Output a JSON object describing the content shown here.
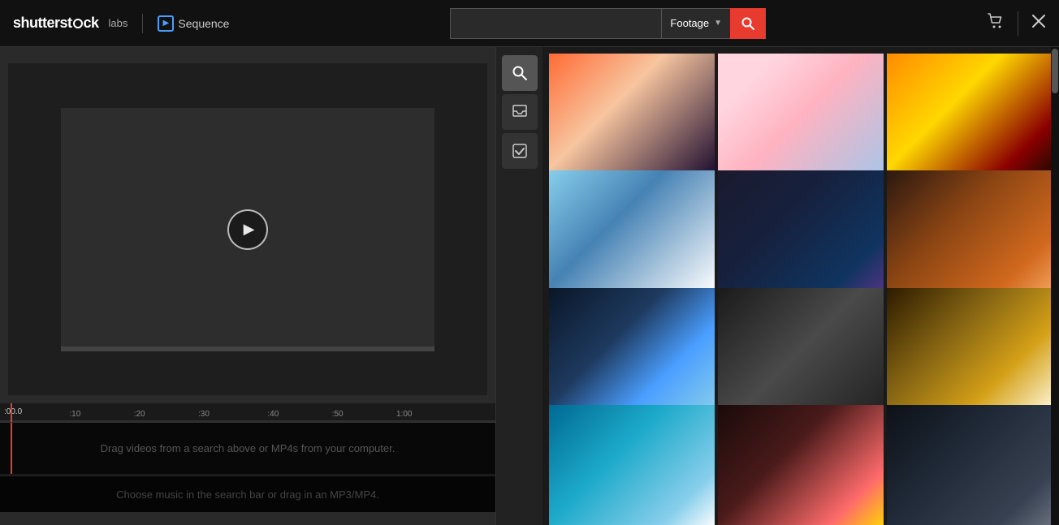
{
  "header": {
    "logo": "shutterstøck",
    "logo_text": "shutterstock",
    "logo_labs": "labs",
    "sequence_label": "Sequence",
    "search_placeholder": "",
    "search_value": "",
    "footage_label": "Footage",
    "search_btn_label": "🔍",
    "cart_icon": "🛒",
    "close_icon": "✕"
  },
  "toolbar": {
    "search_tool_icon": "search",
    "inbox_tool_icon": "inbox",
    "check_tool_icon": "check"
  },
  "timeline": {
    "current_time": ":00.0",
    "markers": [
      ":10",
      ":20",
      ":30",
      ":40",
      ":50",
      "1:00"
    ],
    "marker_positions": [
      14,
      27,
      40,
      54,
      67,
      80
    ],
    "video_track_label": "Drag videos from a search above or MP4s from your computer.",
    "audio_track_label": "Choose music in the search bar or drag in an MP3/MP4."
  },
  "search_panel": {
    "thumbnails": [
      {
        "id": 1,
        "class": "thumb-1"
      },
      {
        "id": 2,
        "class": "thumb-2"
      },
      {
        "id": 3,
        "class": "thumb-3"
      },
      {
        "id": 4,
        "class": "thumb-4"
      },
      {
        "id": 5,
        "class": "thumb-5"
      },
      {
        "id": 6,
        "class": "thumb-6"
      },
      {
        "id": 7,
        "class": "thumb-7"
      },
      {
        "id": 8,
        "class": "thumb-8"
      },
      {
        "id": 9,
        "class": "thumb-9"
      },
      {
        "id": 10,
        "class": "thumb-10"
      },
      {
        "id": 11,
        "class": "thumb-11"
      },
      {
        "id": 12,
        "class": "thumb-12"
      }
    ]
  }
}
